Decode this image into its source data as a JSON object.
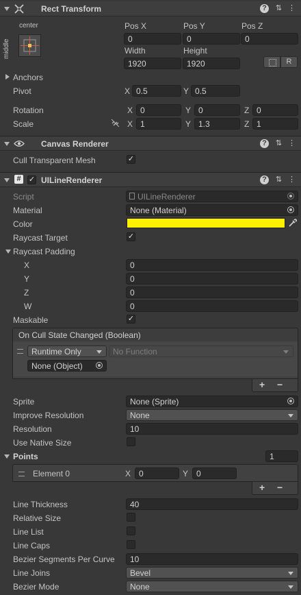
{
  "rect_transform": {
    "title": "Rect Transform",
    "anchor_preset_top": "center",
    "anchor_preset_side": "middle",
    "pos_x_label": "Pos X",
    "pos_y_label": "Pos Y",
    "pos_z_label": "Pos Z",
    "pos_x": "0",
    "pos_y": "0",
    "pos_z": "0",
    "width_label": "Width",
    "height_label": "Height",
    "width": "1920",
    "height": "1920",
    "r_button": "R",
    "anchors_label": "Anchors",
    "pivot_label": "Pivot",
    "pivot_x": "0.5",
    "pivot_y": "0.5",
    "rotation_label": "Rotation",
    "rot_x": "0",
    "rot_y": "0",
    "rot_z": "0",
    "scale_label": "Scale",
    "scale_x": "1",
    "scale_y": "1.3",
    "scale_z": "1",
    "x": "X",
    "y": "Y",
    "z": "Z"
  },
  "canvas_renderer": {
    "title": "Canvas Renderer",
    "cull_label": "Cull Transparent Mesh",
    "cull_checked": true
  },
  "ui_line_renderer": {
    "title": "UILineRenderer",
    "script_label": "Script",
    "script_value": "UILineRenderer",
    "material_label": "Material",
    "material_value": "None (Material)",
    "color_label": "Color",
    "color_value": "#fff200",
    "raycast_target_label": "Raycast Target",
    "raycast_padding_label": "Raycast Padding",
    "pad_x_label": "X",
    "pad_x": "0",
    "pad_y_label": "Y",
    "pad_y": "0",
    "pad_z_label": "Z",
    "pad_z": "0",
    "pad_w_label": "W",
    "pad_w": "0",
    "maskable_label": "Maskable",
    "event_title": "On Cull State Changed (Boolean)",
    "runtime_only": "Runtime Only",
    "no_function": "No Function",
    "none_object": "None (Object)",
    "plus": "+",
    "minus": "−",
    "sprite_label": "Sprite",
    "sprite_value": "None (Sprite)",
    "improve_label": "Improve Resolution",
    "improve_value": "None",
    "resolution_label": "Resolution",
    "resolution_value": "10",
    "native_label": "Use Native Size",
    "points_label": "Points",
    "points_count": "1",
    "element0_label": "Element 0",
    "el_x": "0",
    "el_y": "0",
    "line_thickness_label": "Line Thickness",
    "line_thickness": "40",
    "relative_size_label": "Relative Size",
    "line_list_label": "Line List",
    "line_caps_label": "Line Caps",
    "bezier_segments_label": "Bezier Segments Per Curve",
    "bezier_segments": "10",
    "line_joins_label": "Line Joins",
    "line_joins": "Bevel",
    "bezier_mode_label": "Bezier Mode",
    "bezier_mode": "None"
  }
}
